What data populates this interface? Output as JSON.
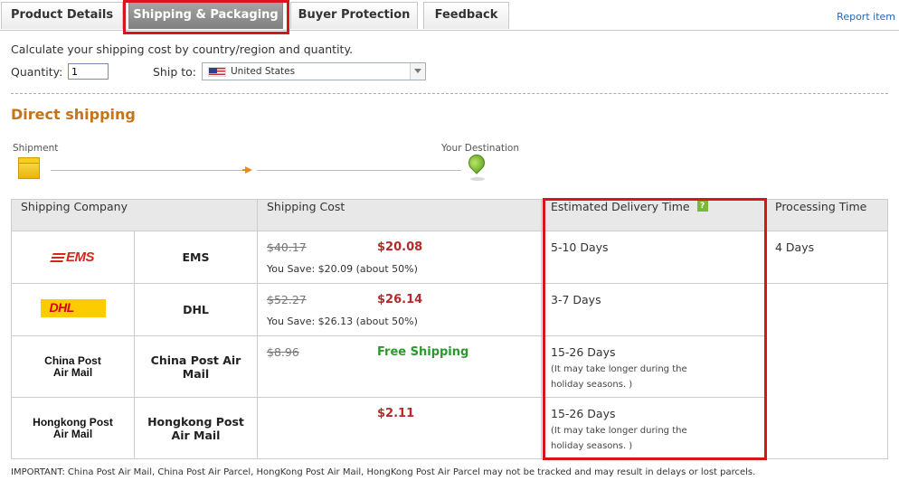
{
  "tabs": [
    {
      "label": "Product Details",
      "active": false
    },
    {
      "label": "Shipping & Packaging",
      "active": true
    },
    {
      "label": "Buyer Protection",
      "active": false
    },
    {
      "label": "Feedback",
      "active": false
    }
  ],
  "report_link": "Report item",
  "calculator": {
    "description": "Calculate your shipping cost by country/region and quantity.",
    "quantity_label": "Quantity:",
    "quantity_value": "1",
    "ship_to_label": "Ship to:",
    "ship_to_value": "United States"
  },
  "section_title": "Direct shipping",
  "route": {
    "origin_label": "Shipment",
    "destination_label": "Your Destination"
  },
  "table": {
    "headers": {
      "company": "Shipping Company",
      "cost": "Shipping Cost",
      "delivery": "Estimated Delivery Time",
      "processing": "Processing Time"
    },
    "help_glyph": "?",
    "rows": [
      {
        "logo": "EMS",
        "name": "EMS",
        "original_price": "$40.17",
        "price": "$20.08",
        "savings": "You Save: $20.09 (about 50%)",
        "delivery": "5-10 Days",
        "note": "",
        "processing": "4 Days"
      },
      {
        "logo": "DHL",
        "name": "DHL",
        "original_price": "$52.27",
        "price": "$26.14",
        "savings": "You Save: $26.13 (about 50%)",
        "delivery": "3-7 Days",
        "note": "",
        "processing": ""
      },
      {
        "logo_line1": "China Post",
        "logo_line2": "Air Mail",
        "name_line1": "China Post Air",
        "name_line2": "Mail",
        "original_price": "$8.96",
        "price": "Free Shipping",
        "savings": "",
        "delivery": "15-26 Days",
        "note_line1": "(It may take longer during the",
        "note_line2": "holiday seasons. )"
      },
      {
        "logo_line1": "Hongkong Post",
        "logo_line2": "Air Mail",
        "name_line1": "Hongkong Post",
        "name_line2": "Air Mail",
        "original_price": "",
        "price": "$2.11",
        "savings": "",
        "delivery": "15-26 Days",
        "note_line1": "(It may take longer during the",
        "note_line2": "holiday seasons. )"
      }
    ]
  },
  "important_note": "IMPORTANT: China Post Air Mail, China Post Air Parcel, HongKong Post Air Mail, HongKong Post Air Parcel may not be tracked and may result in delays or lost parcels.",
  "colors": {
    "highlight_box": "#d7161b",
    "section_title": "#c4751a",
    "price": "#b52a2a",
    "free_shipping": "#2b9a2b",
    "link": "#2a64b4"
  }
}
